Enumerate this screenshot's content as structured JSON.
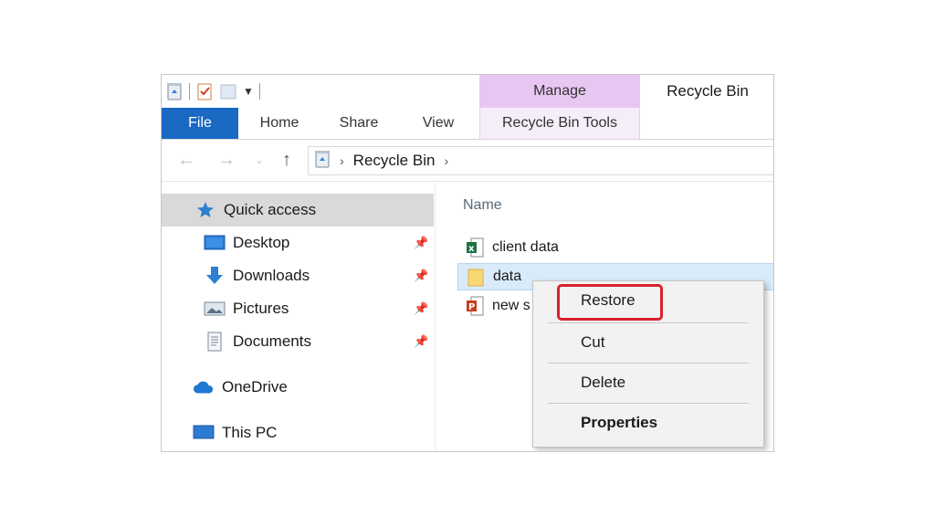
{
  "window": {
    "title": "Recycle Bin",
    "manage_label": "Manage"
  },
  "ribbon": {
    "tabs": [
      {
        "label": "File"
      },
      {
        "label": "Home"
      },
      {
        "label": "Share"
      },
      {
        "label": "View"
      },
      {
        "label": "Recycle Bin Tools"
      }
    ]
  },
  "address": {
    "path": [
      "Recycle Bin"
    ]
  },
  "sidebar": {
    "quick_access": "Quick access",
    "items": [
      {
        "label": "Desktop",
        "icon": "desktop-icon"
      },
      {
        "label": "Downloads",
        "icon": "download-icon"
      },
      {
        "label": "Pictures",
        "icon": "pictures-icon"
      },
      {
        "label": "Documents",
        "icon": "documents-icon"
      }
    ],
    "onedrive": "OneDrive",
    "this_pc": "This PC"
  },
  "content": {
    "column_name": "Name",
    "files": [
      {
        "name": "client data",
        "icon": "excel-icon"
      },
      {
        "name": "data",
        "icon": "folder-icon",
        "selected": true
      },
      {
        "name": "new s",
        "icon": "powerpoint-icon"
      }
    ]
  },
  "context_menu": {
    "items": [
      {
        "label": "Restore",
        "highlighted": true
      },
      {
        "label": "Cut"
      },
      {
        "label": "Delete"
      },
      {
        "label": "Properties",
        "bold": true
      }
    ]
  },
  "colors": {
    "file_tab": "#1a6ac4",
    "manage_tab": "#e8c6f2",
    "selection": "#d9ebf9",
    "highlight_border": "#d8222a"
  }
}
